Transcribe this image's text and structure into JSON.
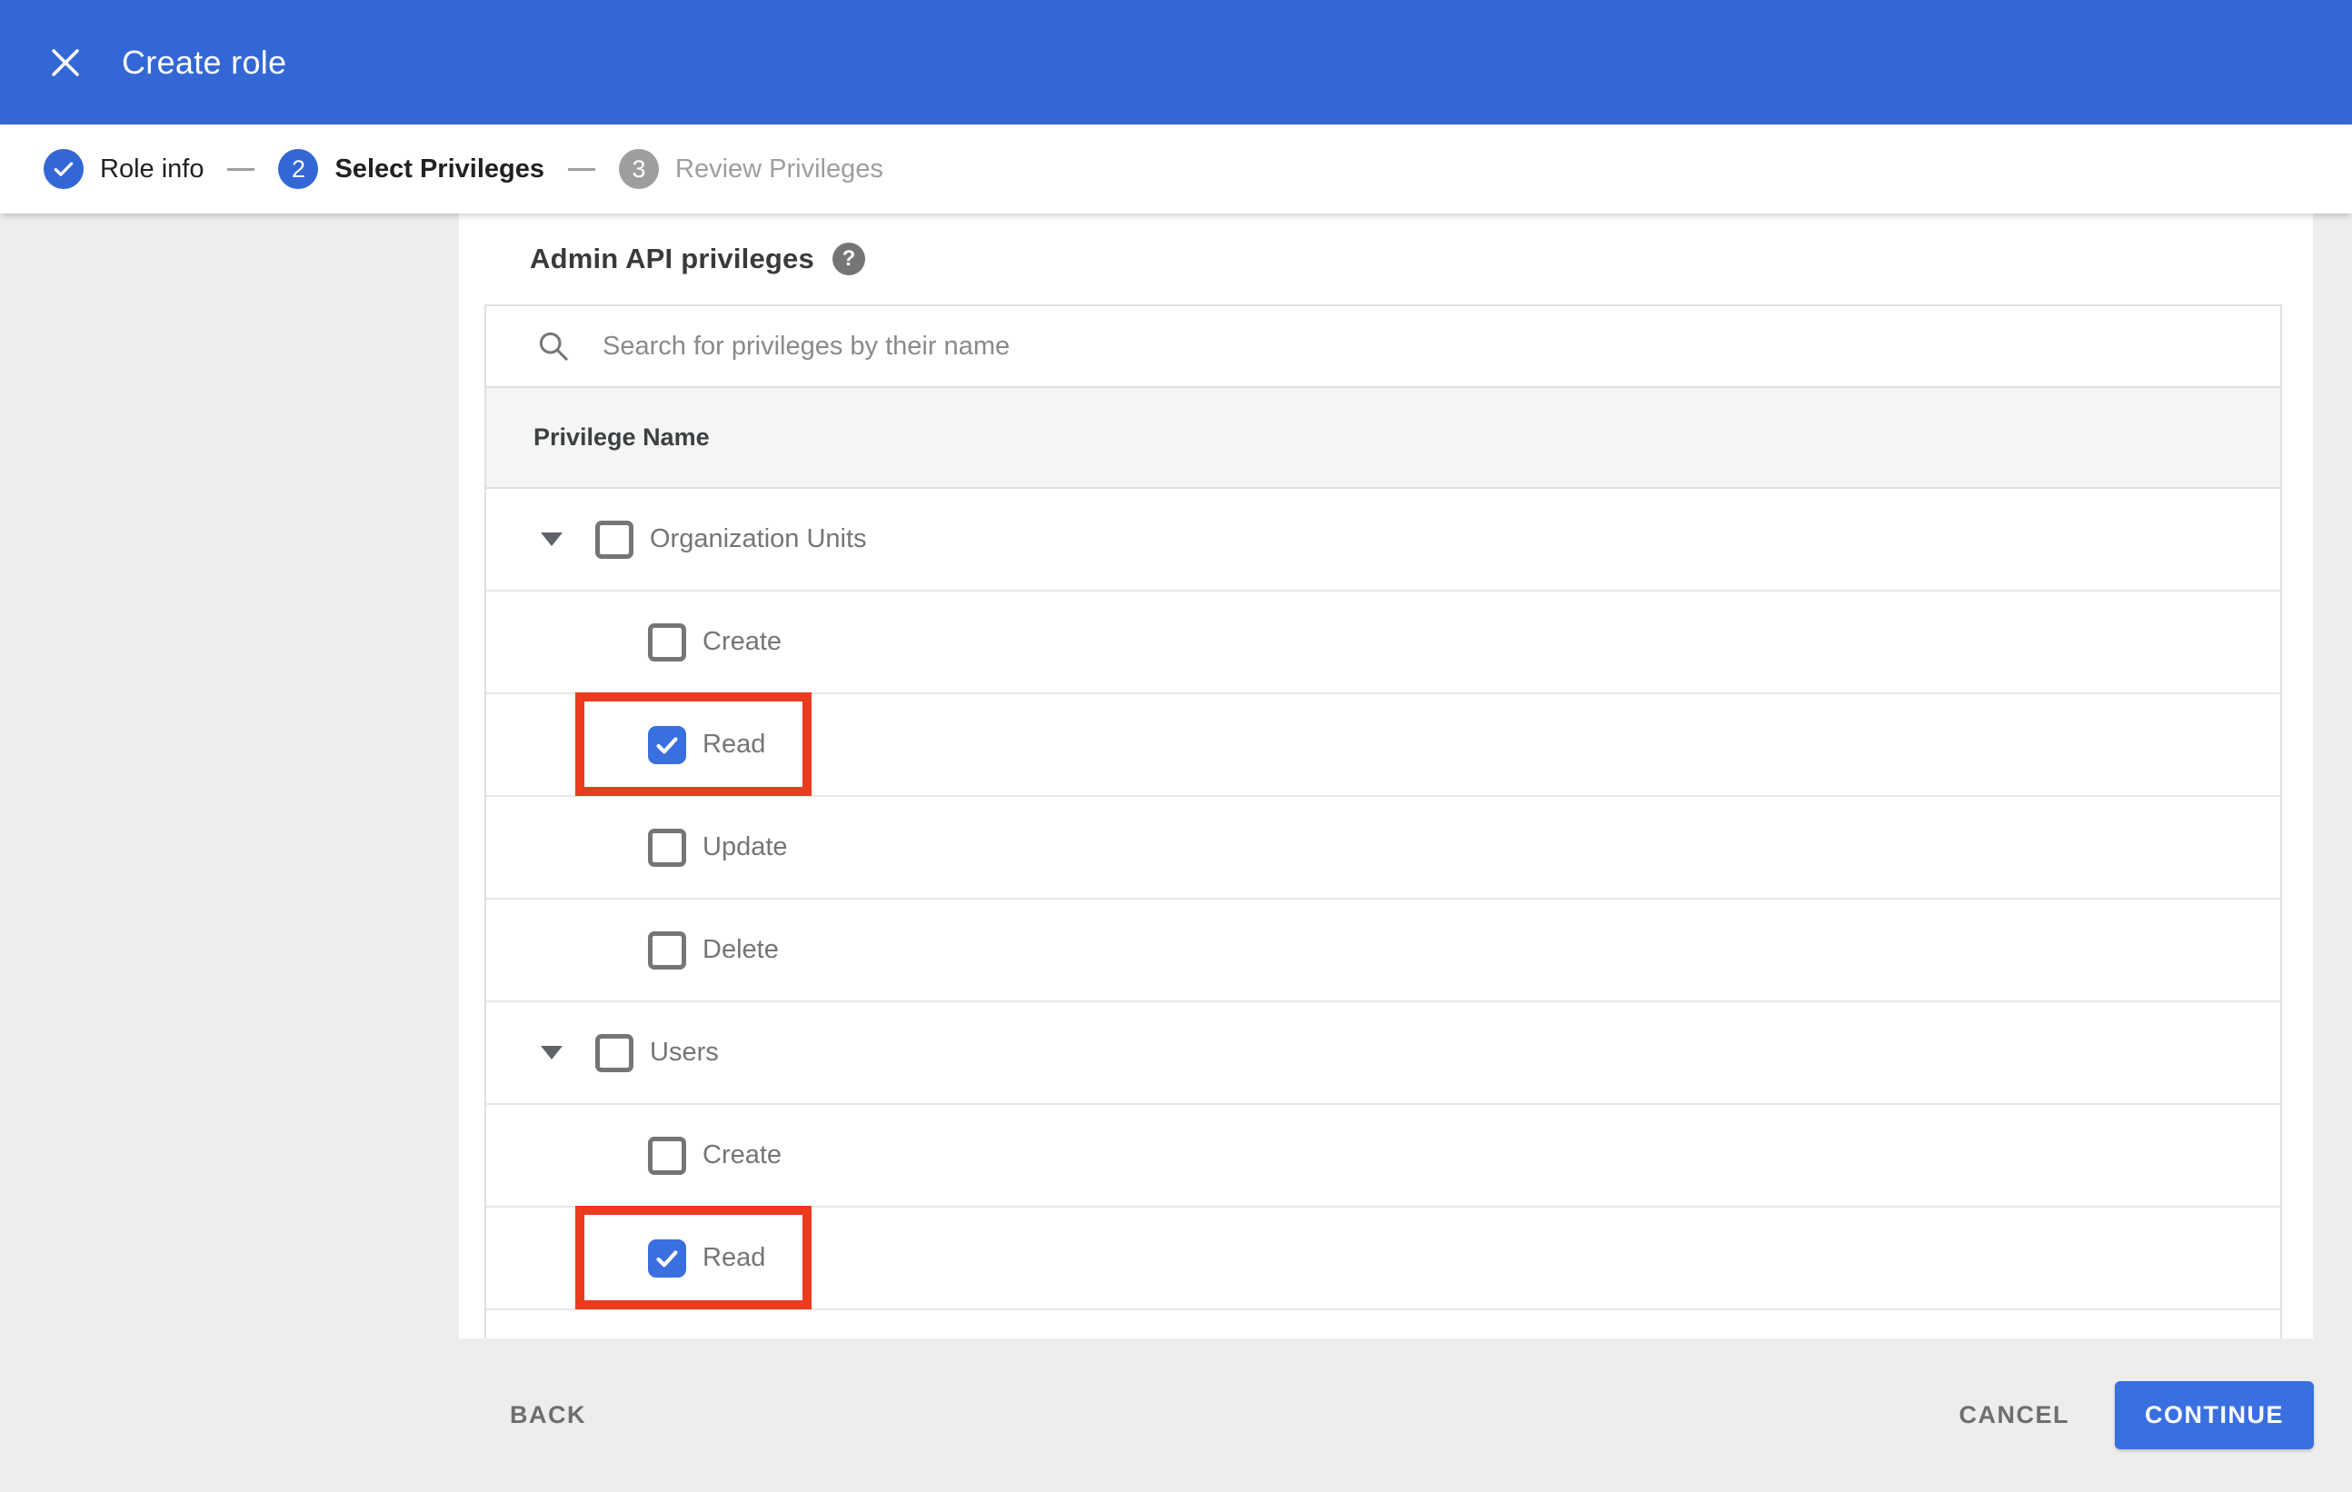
{
  "appbar": {
    "title": "Create role",
    "close_icon": "close-x"
  },
  "stepper": {
    "steps": [
      {
        "label": "Role info",
        "state": "complete",
        "marker": "check"
      },
      {
        "label": "Select Privileges",
        "state": "active",
        "number": "2"
      },
      {
        "label": "Review Privileges",
        "state": "upcoming",
        "number": "3"
      }
    ]
  },
  "content": {
    "section_title": "Admin API privileges",
    "help_icon": "question-mark",
    "help_glyph": "?",
    "search": {
      "placeholder": "Search for privileges by their name",
      "value": "",
      "icon": "search-magnifier"
    },
    "table": {
      "header": "Privilege Name",
      "rows": [
        {
          "label": "Organization Units",
          "level": "parent",
          "checked": false,
          "expanded": true,
          "highlighted": false
        },
        {
          "label": "Create",
          "level": "child",
          "checked": false,
          "highlighted": false
        },
        {
          "label": "Read",
          "level": "child",
          "checked": true,
          "highlighted": true
        },
        {
          "label": "Update",
          "level": "child",
          "checked": false,
          "highlighted": false
        },
        {
          "label": "Delete",
          "level": "child",
          "checked": false,
          "highlighted": false
        },
        {
          "label": "Users",
          "level": "parent",
          "checked": false,
          "expanded": true,
          "highlighted": false
        },
        {
          "label": "Create",
          "level": "child",
          "checked": false,
          "highlighted": false
        },
        {
          "label": "Read",
          "level": "child",
          "checked": true,
          "highlighted": true
        }
      ]
    }
  },
  "footer": {
    "back_label": "BACK",
    "cancel_label": "CANCEL",
    "continue_label": "CONTINUE"
  },
  "colors": {
    "accent_blue": "#3367d6",
    "checkbox_blue": "#3a6fe0",
    "highlight_red": "#ea3b1f",
    "page_gray": "#ededed",
    "table_header_gray": "#f5f5f5"
  }
}
